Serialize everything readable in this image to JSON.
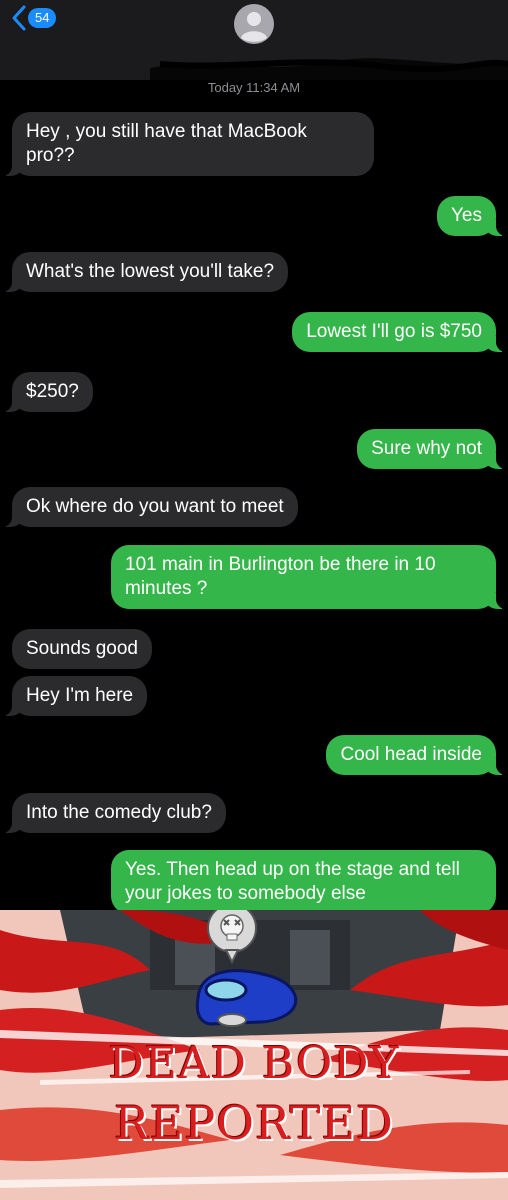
{
  "header": {
    "back_badge": "54",
    "timestamp": "Today 11:34 AM"
  },
  "messages": [
    {
      "side": "in",
      "text": "Hey , you still have that MacBook pro??"
    },
    {
      "side": "out",
      "text": "Yes"
    },
    {
      "side": "in",
      "text": "What's the lowest you'll take?"
    },
    {
      "side": "out",
      "text": "Lowest I'll go is $750"
    },
    {
      "side": "in",
      "text": "$250?"
    },
    {
      "side": "out",
      "text": "Sure why not"
    },
    {
      "side": "in",
      "text": "Ok where do you want to meet"
    },
    {
      "side": "out",
      "text": "101 main in Burlington be there in 10 minutes ?"
    },
    {
      "side": "in",
      "text": "Sounds good"
    },
    {
      "side": "in",
      "text": "Hey I'm here"
    },
    {
      "side": "out",
      "text": "Cool head inside"
    },
    {
      "side": "in",
      "text": "Into the comedy club?"
    },
    {
      "side": "out",
      "text": "Yes. Then head up on the stage and tell your jokes to somebody else"
    }
  ],
  "meme": {
    "line1": "DEAD BODY",
    "line2": "REPORTED"
  },
  "colors": {
    "incoming_bubble": "#2b2b2e",
    "outgoing_bubble": "#35b64a",
    "badge": "#1a8cff",
    "report_red": "#d81e1e"
  }
}
